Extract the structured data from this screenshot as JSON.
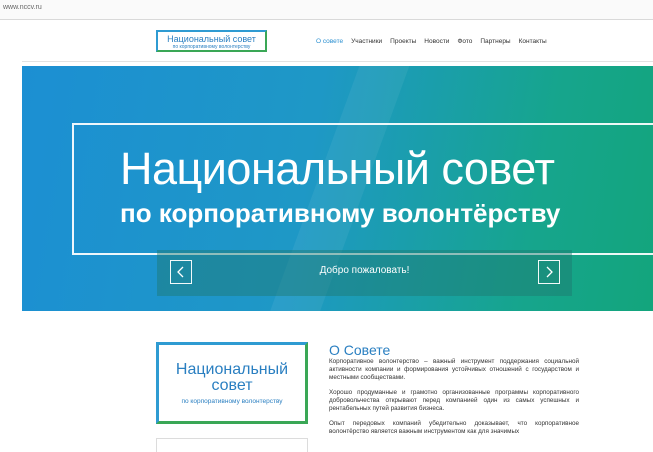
{
  "browser": {
    "url": "www.ncсv.ru"
  },
  "header": {
    "logo": {
      "line1": "Национальный совет",
      "line2": "по корпоративному волонтерству"
    },
    "nav": [
      {
        "label": "О совете",
        "active": true
      },
      {
        "label": "Участники",
        "active": false
      },
      {
        "label": "Проекты",
        "active": false
      },
      {
        "label": "Новости",
        "active": false
      },
      {
        "label": "Фото",
        "active": false
      },
      {
        "label": "Партнеры",
        "active": false
      },
      {
        "label": "Контакты",
        "active": false
      }
    ]
  },
  "hero": {
    "title": "Национальный совет",
    "subtitle": "по корпоративному волонтёрству",
    "slider": {
      "text": "Добро пожаловать!",
      "prev_icon": "chevron-left-icon",
      "next_icon": "chevron-right-icon"
    }
  },
  "logo_big": {
    "line1": "Национальный",
    "line2": "совет",
    "line3": "по корпоративному волонтерству"
  },
  "about": {
    "title": "О Совете",
    "paragraphs": [
      "Корпоративное волонтерство – важный инструмент поддержания социальной активности компании и формирования устойчивых отношений с государством и местными сообществами.",
      "Хорошо продуманные и грамотно организованные программы корпоративного добровольчества открывают перед компанией один из самых успешных и рентабельных путей развития бизнеса.",
      "Опыт передовых компаний убедительно доказывает, что корпоративное волонтёрство является важным инструментом как для значимых"
    ]
  },
  "colors": {
    "blue": "#2a7fc1",
    "green": "#3aa756",
    "hero_start": "#1c8fd3",
    "hero_end": "#13a57c"
  }
}
